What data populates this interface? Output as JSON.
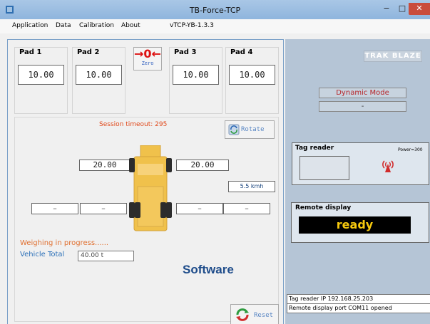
{
  "window": {
    "title": "TB-Force-TCP",
    "minimize": "−",
    "maximize": "□",
    "close": "✕"
  },
  "menu": {
    "items": [
      "Application",
      "Data",
      "Calibration",
      "About"
    ],
    "version": "vTCP-YB-1.3.3"
  },
  "pads": [
    {
      "label": "Pad 1",
      "value": "10.00"
    },
    {
      "label": "Pad 2",
      "value": "10.00"
    },
    {
      "label": "Pad 3",
      "value": "10.00"
    },
    {
      "label": "Pad 4",
      "value": "10.00"
    }
  ],
  "zero_button": {
    "arrows": "→0←",
    "label": "Zero"
  },
  "session": {
    "text": "Session timeout:  295"
  },
  "rotate_button": {
    "label": "Rotate"
  },
  "axles": {
    "axle1": [
      "20.00",
      "20.00"
    ],
    "axle2": [
      "–",
      "–",
      "–",
      "–"
    ]
  },
  "speed": "5.5 kmh",
  "status": {
    "weighing": "Weighing in progress......",
    "vehicle_total_label": "Vehicle Total",
    "vehicle_total_value": "40.00 t"
  },
  "reset_button": {
    "label": "Reset"
  },
  "overlay_label": "Software",
  "right": {
    "brand": "TRAK BLAZE",
    "mode": "Dynamic Mode",
    "mode_sub": "-",
    "tag_reader": {
      "title": "Tag reader",
      "power": "Power=300"
    },
    "remote_display": {
      "title": "Remote display",
      "text": "ready"
    },
    "status_lines": [
      "Tag reader IP 192.168.25.203",
      "Remote display port COM11 opened"
    ]
  },
  "colors": {
    "accent_red": "#d11",
    "display_bg": "#000000",
    "display_fg": "#f6c90e",
    "truck": "#f0c14b"
  }
}
